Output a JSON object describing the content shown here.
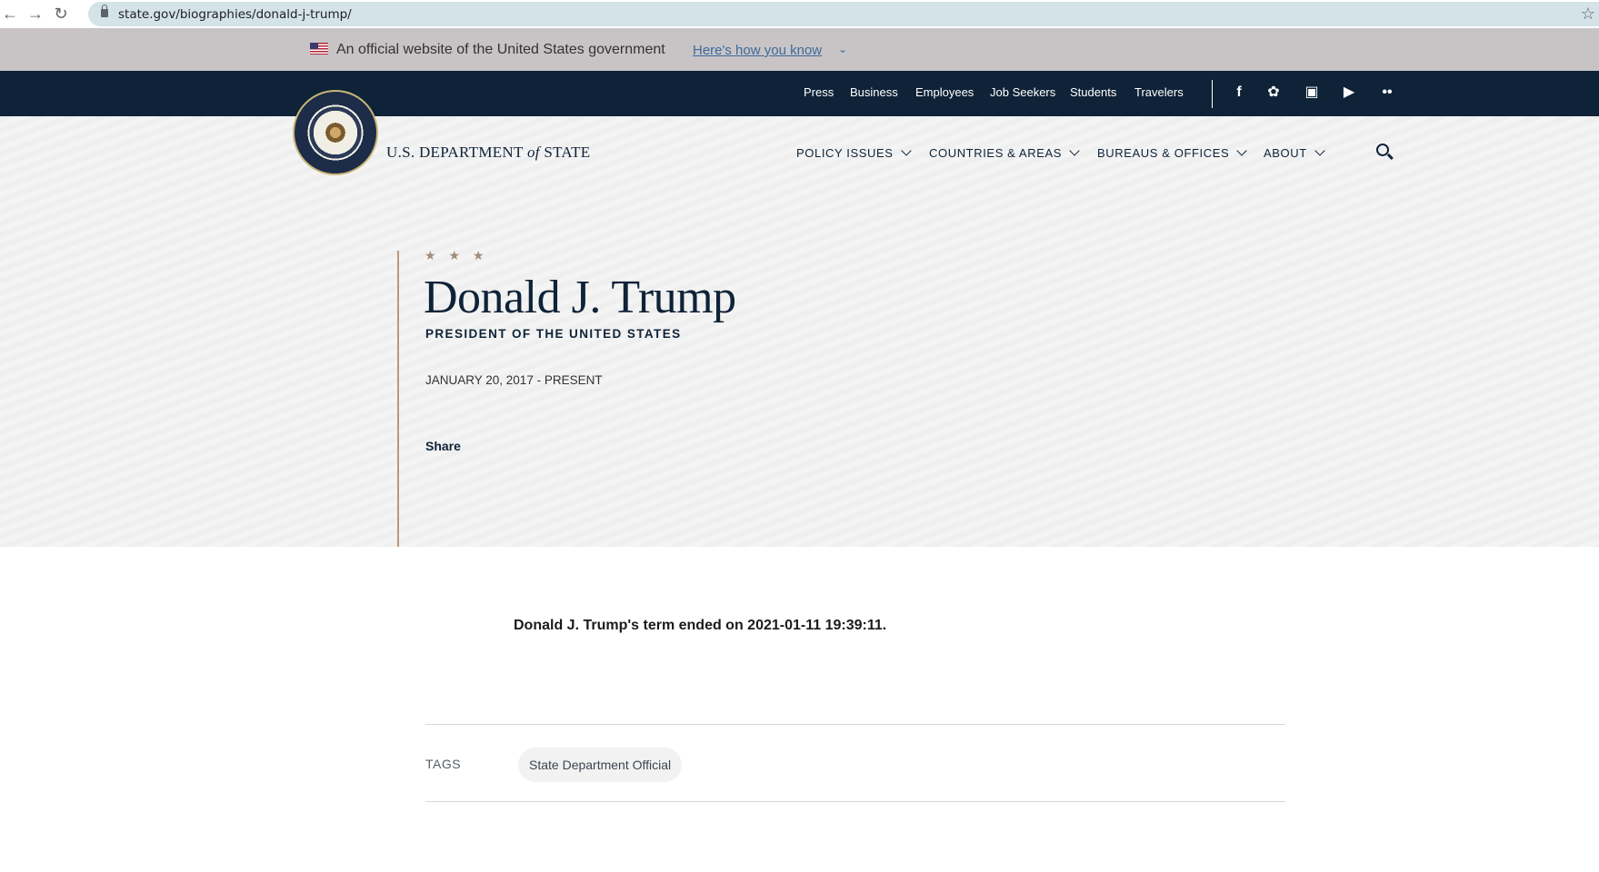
{
  "browser": {
    "url": "state.gov/biographies/donald-j-trump/"
  },
  "official_banner": {
    "text": "An official website of the United States government",
    "link": "Here's how you know"
  },
  "topbar": {
    "links": [
      "Press",
      "Business",
      "Employees",
      "Job Seekers",
      "Students",
      "Travelers"
    ],
    "social": [
      "facebook-icon",
      "twitter-icon",
      "instagram-icon",
      "youtube-icon",
      "flickr-icon"
    ]
  },
  "header": {
    "dept_prefix": "U.S. DEPARTMENT",
    "dept_of": "of",
    "dept_suffix": "STATE",
    "nav": [
      "POLICY ISSUES",
      "COUNTRIES & AREAS",
      "BUREAUS & OFFICES",
      "ABOUT"
    ]
  },
  "bio": {
    "stars": "★ ★ ★",
    "name": "Donald J. Trump",
    "title": "PRESIDENT OF THE UNITED STATES",
    "dates": "JANUARY 20, 2017 - PRESENT",
    "share": "Share"
  },
  "content": {
    "term_text": "Donald J. Trump's term ended on 2021-01-11 19:39:11.",
    "tags_label": "TAGS",
    "tags": [
      "State Department Official"
    ]
  }
}
